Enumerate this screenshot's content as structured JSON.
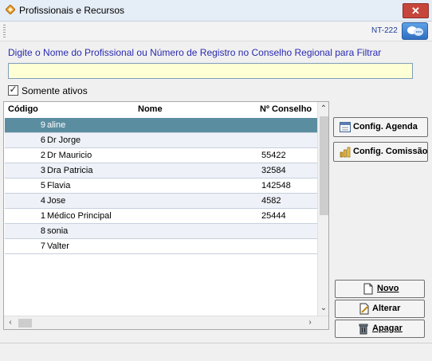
{
  "window": {
    "title": "Profissionais e Recursos",
    "close_label": "✕"
  },
  "toolbar": {
    "nt_label": "NT-222"
  },
  "filter": {
    "label": "Digite o Nome do Profissional ou Número de Registro no Conselho Regional para Filtrar",
    "value": "",
    "checkbox_label": "Somente ativos",
    "checkbox_checked": true
  },
  "grid": {
    "columns": [
      "Código",
      "Nome",
      "Nº Conselho"
    ],
    "rows": [
      {
        "code": "9",
        "name": "aline",
        "conselho": ""
      },
      {
        "code": "6",
        "name": "Dr Jorge",
        "conselho": ""
      },
      {
        "code": "2",
        "name": "Dr Mauricio",
        "conselho": "55422"
      },
      {
        "code": "3",
        "name": "Dra Patricia",
        "conselho": "32584"
      },
      {
        "code": "5",
        "name": "Flavia",
        "conselho": "142548"
      },
      {
        "code": "4",
        "name": "Jose",
        "conselho": "4582"
      },
      {
        "code": "1",
        "name": "Médico Principal",
        "conselho": "25444"
      },
      {
        "code": "8",
        "name": "sonia",
        "conselho": ""
      },
      {
        "code": "7",
        "name": "Valter",
        "conselho": ""
      }
    ],
    "selected_index": 0
  },
  "side_buttons": {
    "config_agenda": "Config. Agenda",
    "config_comissao": "Config. Comissão"
  },
  "action_buttons": {
    "novo": "Novo",
    "alterar": "Alterar",
    "apagar": "Apagar"
  },
  "colors": {
    "selected_row": "#5b8da0",
    "filter_label": "#2a2ab2",
    "filter_bg": "#ffffd6",
    "close_button": "#c7463b"
  }
}
